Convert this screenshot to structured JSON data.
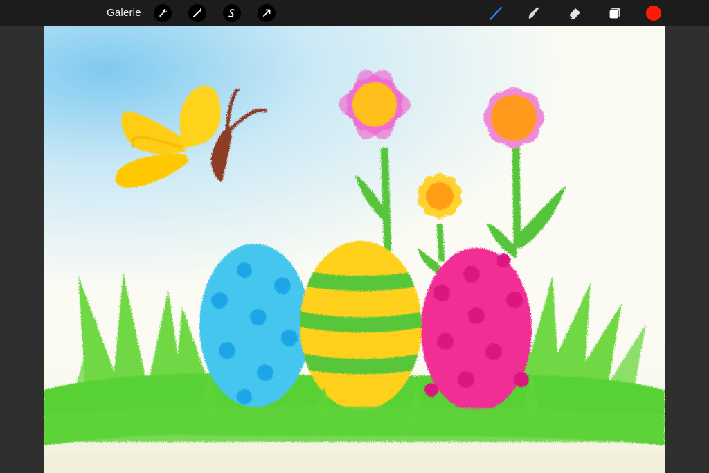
{
  "toolbar": {
    "gallery_label": "Galerie",
    "left_tools": [
      {
        "name": "actions-wrench-icon"
      },
      {
        "name": "adjustments-magic-wand-icon"
      },
      {
        "name": "selection-s-icon"
      },
      {
        "name": "transform-arrow-icon"
      }
    ],
    "right_tools": [
      {
        "name": "paint-brush-icon"
      },
      {
        "name": "smudge-finger-icon"
      },
      {
        "name": "eraser-icon"
      },
      {
        "name": "layers-icon"
      }
    ],
    "current_color": "#ff1a0a"
  },
  "colors": {
    "sky": "#8fd0f0",
    "paper": "#fbfbf4",
    "grass": "#5cd33a",
    "butterfly": "#ffce1f",
    "pink_flower": "#ee6ed4",
    "light_pink_flower": "#f08ad8",
    "yellow_flower": "#ffd22e",
    "blue_egg": "#41c4ee",
    "yellow_egg": "#ffd11a",
    "pink_egg": "#f02d95"
  }
}
